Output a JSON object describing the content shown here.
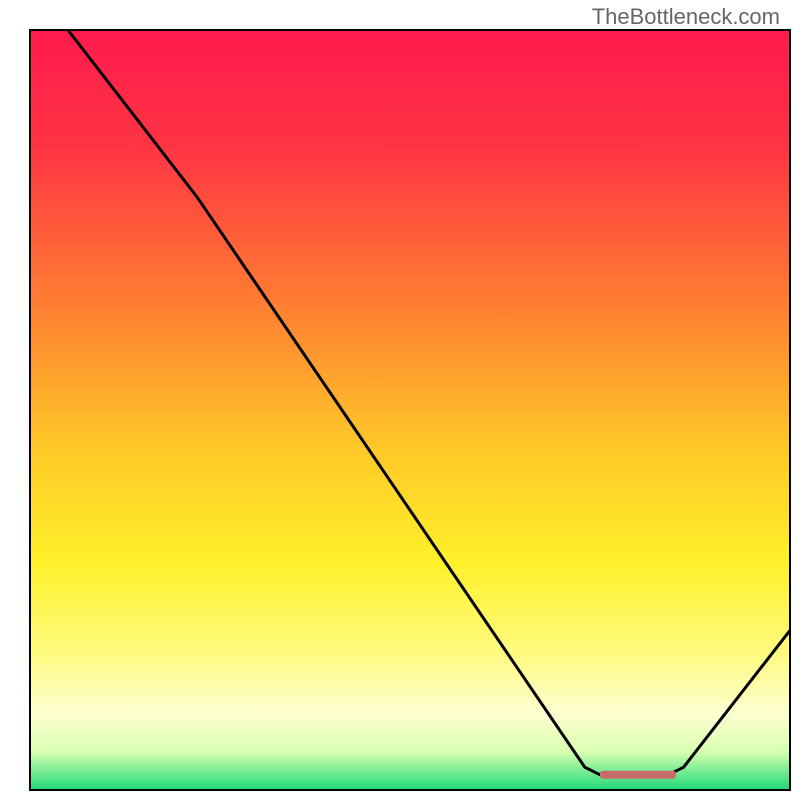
{
  "watermark": "TheBottleneck.com",
  "chart_data": {
    "type": "line",
    "title": "",
    "xlabel": "",
    "ylabel": "",
    "xlim": [
      0,
      100
    ],
    "ylim": [
      0,
      100
    ],
    "series": [
      {
        "name": "curve",
        "points": [
          {
            "x": 5,
            "y": 100
          },
          {
            "x": 22,
            "y": 78
          },
          {
            "x": 73,
            "y": 3
          },
          {
            "x": 75,
            "y": 2
          },
          {
            "x": 84,
            "y": 2
          },
          {
            "x": 86,
            "y": 3
          },
          {
            "x": 100,
            "y": 21
          }
        ]
      }
    ],
    "flat_segment": {
      "x_start": 75,
      "x_end": 85,
      "y": 2,
      "color": "#c76b6b"
    },
    "gradient_stops": [
      {
        "offset": 0,
        "color": "#ff1a4d"
      },
      {
        "offset": 15,
        "color": "#ff3344"
      },
      {
        "offset": 35,
        "color": "#ff7a33"
      },
      {
        "offset": 55,
        "color": "#ffc828"
      },
      {
        "offset": 70,
        "color": "#fff02a"
      },
      {
        "offset": 82,
        "color": "#fffb80"
      },
      {
        "offset": 90,
        "color": "#fdffd0"
      },
      {
        "offset": 95,
        "color": "#d8ffb0"
      },
      {
        "offset": 97,
        "color": "#8cf09a"
      },
      {
        "offset": 100,
        "color": "#1fd87a"
      }
    ],
    "border_color": "#000000"
  }
}
